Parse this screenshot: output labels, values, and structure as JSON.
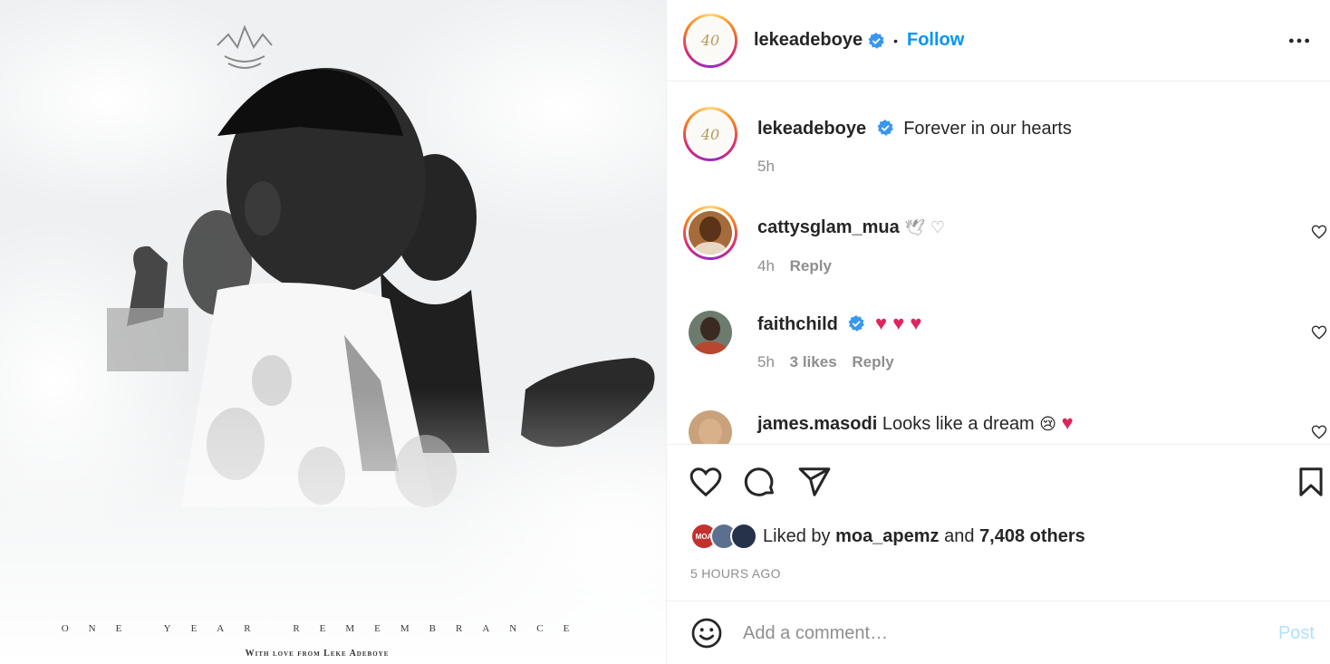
{
  "post": {
    "image_alt": "Memorial poster with portraits of men in prayer",
    "caption_line1": "ONE YEAR REMEMBRANCE",
    "caption_line2": "With love from Leke Adeboye",
    "avatar_logo_text": "40"
  },
  "header": {
    "username": "lekeadeboye",
    "separator": "•",
    "follow_label": "Follow",
    "more_icon": "more-horizontal-icon"
  },
  "comments": [
    {
      "username": "lekeadeboye",
      "text": "Forever in our hearts",
      "time": "5h",
      "verified": true,
      "is_caption": true
    },
    {
      "username": "cattysglam_mua",
      "text": "🕊 ♡",
      "time": "4h",
      "reply_label": "Reply"
    },
    {
      "username": "faithchild",
      "text": "♥ ♥ ♥",
      "time": "5h",
      "likes": "3 likes",
      "reply_label": "Reply",
      "verified": true
    },
    {
      "username": "james.masodi",
      "text": "Looks like a dream",
      "emoji": "😢",
      "heart": "♥"
    }
  ],
  "actions": {
    "like_icon": "heart-icon",
    "comment_icon": "comment-icon",
    "share_icon": "send-icon",
    "save_icon": "bookmark-icon"
  },
  "likes": {
    "prefix": "Liked by",
    "user": "moa_apemz",
    "middle": "and",
    "count": "7,408 others",
    "avatar_badge": "MOA"
  },
  "timestamp": "5 HOURS AGO",
  "composer": {
    "placeholder": "Add a comment…",
    "post_label": "Post"
  },
  "colors": {
    "accent": "#0095f6",
    "verified": "#3897f0",
    "muted": "#8e8e8e",
    "post_disabled": "#b2dffc",
    "heart_red": "#e0245e"
  }
}
